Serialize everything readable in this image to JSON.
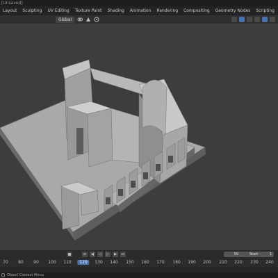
{
  "window": {
    "title": "[Unsaved]"
  },
  "menubar": {
    "tabs": [
      "Layout",
      "Sculpting",
      "UV Editing",
      "Texture Paint",
      "Shading",
      "Animation",
      "Rendering",
      "Compositing",
      "Geometry Nodes",
      "Scripting",
      "+"
    ]
  },
  "header": {
    "orientation": "Global",
    "icons": [
      "view-icon",
      "link-icon",
      "snap-icon",
      "proportional-icon",
      "gizmo-icon",
      "overlay-icon",
      "xray-icon",
      "shading-solid-icon"
    ]
  },
  "timeline": {
    "frame_current": "50",
    "start_label": "Start",
    "start_value": "1",
    "ruler_ticks": [
      "70",
      "80",
      "90",
      "100",
      "110",
      "120",
      "130",
      "140",
      "150",
      "160",
      "170",
      "180",
      "190",
      "200",
      "210",
      "220",
      "230",
      "240"
    ],
    "highlight": "120"
  },
  "statusbar": {
    "text": "Object Context Menu"
  },
  "colors": {
    "accent": "#4772b3",
    "background": "#3d3d3d",
    "model": "#a0a0a0"
  }
}
